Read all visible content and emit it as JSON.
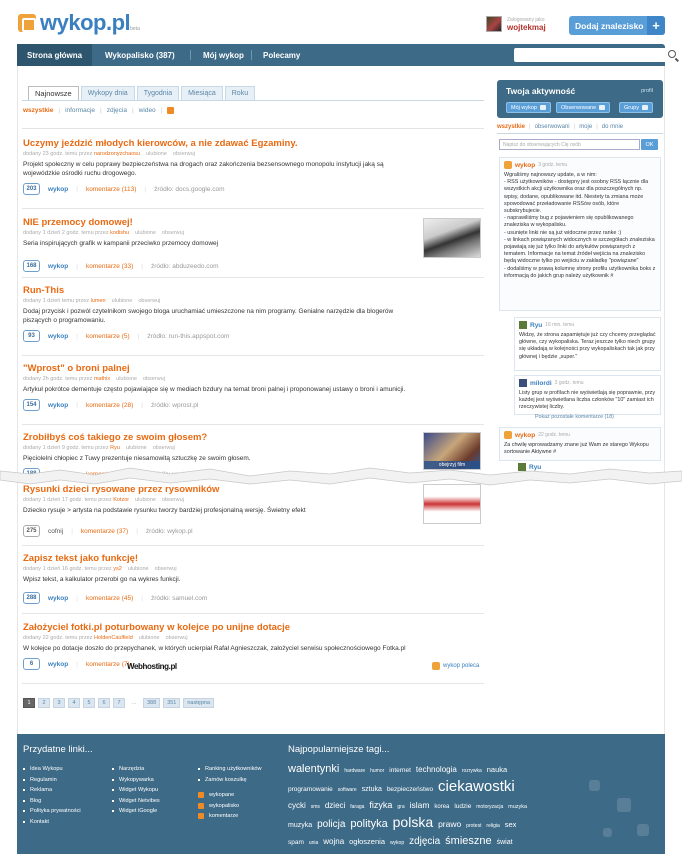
{
  "header": {
    "logo": "wykop.pl",
    "logo_beta": "beta",
    "logged_as": "Zalogowany jako",
    "username": "wojtekmaj",
    "add_button": "Dodaj znalezisko",
    "add_icon": "+"
  },
  "nav": {
    "items": [
      "Strona główna",
      "Wykopalisko (387)",
      "Mój wykop",
      "Polecamy"
    ]
  },
  "main": {
    "tabs": [
      "Najnowsze",
      "Wykopy dnia",
      "Tygodnia",
      "Miesiąca",
      "Roku"
    ],
    "filters": [
      "wszystkie",
      "informacje",
      "zdjęcia",
      "wideo"
    ],
    "entries": [
      {
        "title": "Uczymy jeździć młodych kierowców, a nie zdawać Egzaminy.",
        "meta": "dodany 23 godz. temu przez",
        "author": "narodzonyzchaosu",
        "fav": "ulubione",
        "watch": "obserwuj",
        "body": "Projekt społeczny w celu poprawy bezpieczeństwa na drogach oraz zakończenia bezsensownego monopolu instytucji jaką są wojewódzkie ośrodki ruchu drogowego.",
        "votes": "203",
        "wykop": "wykop",
        "comments": "komentarze (113)",
        "source": "źródło: docs.google.com"
      },
      {
        "title": "NIE przemocy domowej!",
        "meta": "dodany 1 dzień 2 godz. temu przez",
        "author": "kodishu",
        "fav": "ulubione",
        "watch": "obserwuj",
        "body": "Seria inspirujących grafik w kampanii przeciwko przemocy domowej",
        "votes": "168",
        "wykop": "wykop",
        "comments": "komentarze (33)",
        "source": "źródło: abduzeedo.com"
      },
      {
        "title": "Run-This",
        "meta": "dodany 1 dzień temu przez",
        "author": "lumen",
        "fav": "ulubione",
        "watch": "obserwuj",
        "body": "Dodaj przycisk i pozwól czytelnikom swojego bloga uruchamiać umieszczone na nim programy. Genialne narzędzie dla blogerów piszących o programowaniu.",
        "votes": "93",
        "wykop": "wykop",
        "comments": "komentarze (5)",
        "source": "źródło: run-this.appspot.com"
      },
      {
        "title": "\"Wprost\" o broni palnej",
        "meta": "dodany 2h godz. temu przez",
        "author": "mathix",
        "fav": "ulubione",
        "watch": "obserwuj",
        "body": "Artykuł pokrótce dementuje często pojawiające się w mediach bzdury na temat broni palnej i proponowanej ustawy o broni i amunicji.",
        "votes": "154",
        "wykop": "wykop",
        "comments": "komentarze (28)",
        "source": "źródło: wprost.pl"
      },
      {
        "title": "Zrobiłbyś coś takiego ze swoim głosem?",
        "meta": "dodany 1 dzień 9 godz. temu przez",
        "author": "Ryu",
        "fav": "ulubione",
        "watch": "obserwuj",
        "body": "Pięciolelni chłopiec z Tuwy prezentuje niesamowitą sztuczkę ze swoim głosem.",
        "votes": "188",
        "wykop": "wykop",
        "comments": "komentarze (51)",
        "source": "źródło: youtube.com",
        "thumb_label": "obejrzyj film"
      },
      {
        "title": "Rysunki dzieci rysowane przez rysowników",
        "meta": "dodany 1 dzień 17 godz. temu przez",
        "author": "Kotzor",
        "fav": "ulubione",
        "watch": "obserwuj",
        "body": "Dziecko rysuje > artysta na podstawie rysunku tworzy bardziej profesjonalną wersję. Świetny efekt",
        "votes": "275",
        "wykop": "cofnij",
        "comments": "komentarze (37)",
        "source": "źródło: wykop.pl"
      },
      {
        "title": "Zapisz tekst jako funkcję!",
        "meta": "dodany 1 dzień 16 godz. temu przez",
        "author": "ys2",
        "fav": "ulubione",
        "watch": "obserwuj",
        "body": "Wpisz tekst, a kalkulator przerobi go na wykres funkcji.",
        "votes": "288",
        "wykop": "wykop",
        "comments": "komentarze (45)",
        "source": "źródło: samuel.com"
      },
      {
        "title": "Założyciel fotki.pl poturbowany w kolejce po unijne dotacje",
        "meta": "dodany 22 godz. temu przez",
        "author": "HoldenCaulfield",
        "fav": "ulubione",
        "watch": "obserwuj",
        "body": "W kolejce po dotacje doszło do przepychanek, w których ucierpiał Rafał Agnieszczak, założyciel serwisu społecznościowego Fotka.pl",
        "votes": "6",
        "wykop": "wykop",
        "comments": "komentarze (7)",
        "source": ""
      }
    ],
    "sponsor": "Webhosting.pl",
    "poleca": "wykop poleca",
    "pager": [
      "1",
      "2",
      "3",
      "4",
      "5",
      "6",
      "7",
      "...",
      "388",
      "351",
      "następna"
    ]
  },
  "sidebar": {
    "title": "Twoja aktywność",
    "profil": "profil",
    "buttons": [
      "Mój wykop",
      "Obserwowane",
      "Grupy"
    ],
    "tabs": [
      "wszystkie",
      "obserwowani",
      "moje",
      "do mnie"
    ],
    "search_placeholder": "Napisz do obserwujących Cię osób",
    "ok": "OK",
    "post1": {
      "who": "wykop",
      "time": "3 godz. temu",
      "body": "Wgraliśmy najnowszy update, a w nim:\n- RSS użytkowników - dostępny jest osobny RSS łącznie dla wszystkich akcji użytkownika oraz dla poszczególnych np. wpisy, dodane, opublikowane itd. Niestety ta zmiana może spowodować przeładowanie RSSów osób, które subskrybujecie.\n- naprawiliśmy bug z pojawieniem się opublikowanego znaleziska w wykopalisku.\n- usunięte linki nie są już widoczne przez ranke :)\n- w linkach powiązanych widocznych w szczegółach znaleziska pojawiają się już tylko linki do artykułów powiązanych z tematem. Informacje na temat źródeł wejścia na znalezisko będą widoczne tylko po wejściu w zakładkę \"powiązane\"\n- dodaliśmy w prawą kolumnę strony profilu użytkownika boks z informacją do jakich grup należy użytkownik #"
    },
    "reply1": {
      "who": "Ryu",
      "time": "16 min. temu",
      "body": "Widzę, że strona zapamiętuje już czy chcemy przeglądać główne, czy wykopaliska. Teraz jeszcze tylko niech grupy się układają w kolejności przy wykopaliskach tak jak przy głównej i będzie „super.\""
    },
    "reply2": {
      "who": "milordi",
      "time": "3 godz. temu",
      "body": "Listy grup w profilach nie wyświetlają się poprawnie, przy każdej jest wyświetlana liczba członków \"10\" zamiast ich rzeczywistej liczby."
    },
    "more_comments": "Pokaż pozostałe komentarze (18)",
    "post2": {
      "who": "wykop",
      "time": "22 godz. temu",
      "body": "Za chwilę wprowadzamy znane już Wam ze starego Wykopu sortowanie Aktywne #"
    },
    "reply3_who": "Ryu"
  },
  "footer": {
    "useful_title": "Przydatne linki...",
    "col1": [
      "Idea Wykopu",
      "Regulamin",
      "Reklama",
      "Blog",
      "Polityka prywatności",
      "Kontakt"
    ],
    "col2": [
      "Narzędzia",
      "Wykopywarka",
      "Widget Wykopu",
      "Widget Netvibes",
      "Widget iGoogle"
    ],
    "col3": [
      "Ranking użytkowników",
      "Zamów koszulkę"
    ],
    "rss": [
      "wykopane",
      "wykopalisko",
      "komentarze"
    ],
    "tags_title": "Najpopularniejsze tagi...",
    "tags": [
      {
        "t": "walentynki",
        "s": 11
      },
      {
        "t": "hardware",
        "s": 5
      },
      {
        "t": "humor",
        "s": 5
      },
      {
        "t": "internet",
        "s": 6.5
      },
      {
        "t": "technologia",
        "s": 8
      },
      {
        "t": "rozrywka",
        "s": 5
      },
      {
        "t": "nauka",
        "s": 7.5
      },
      {
        "t": "programowanie",
        "s": 6.5
      },
      {
        "t": "software",
        "s": 5
      },
      {
        "t": "sztuka",
        "s": 7
      },
      {
        "t": "bezpieczeństwo",
        "s": 6.5
      },
      {
        "t": "ciekawostki",
        "s": 15
      },
      {
        "t": "cycki",
        "s": 8
      },
      {
        "t": "sms",
        "s": 5
      },
      {
        "t": "dzieci",
        "s": 8
      },
      {
        "t": "faraga",
        "s": 5
      },
      {
        "t": "fizyka",
        "s": 9
      },
      {
        "t": "gra",
        "s": 5
      },
      {
        "t": "islam",
        "s": 8.5
      },
      {
        "t": "korea",
        "s": 6
      },
      {
        "t": "ludzie",
        "s": 6.5
      },
      {
        "t": "motoryzacja",
        "s": 5
      },
      {
        "t": "muzyka",
        "s": 5.5
      },
      {
        "t": "muzyka",
        "s": 7
      },
      {
        "t": "policja",
        "s": 10
      },
      {
        "t": "polityka",
        "s": 11
      },
      {
        "t": "polska",
        "s": 14
      },
      {
        "t": "prawo",
        "s": 8.5
      },
      {
        "t": "protest",
        "s": 5
      },
      {
        "t": "religia",
        "s": 5
      },
      {
        "t": "sex",
        "s": 7.5
      },
      {
        "t": "spam",
        "s": 6.5
      },
      {
        "t": "unia",
        "s": 5
      },
      {
        "t": "wojna",
        "s": 8
      },
      {
        "t": "ogłoszenia",
        "s": 7.5
      },
      {
        "t": "wykop",
        "s": 5
      },
      {
        "t": "zdjęcia",
        "s": 10
      },
      {
        "t": "śmieszne",
        "s": 11
      },
      {
        "t": "świat",
        "s": 7
      }
    ]
  }
}
